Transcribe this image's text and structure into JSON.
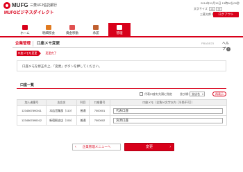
{
  "header": {
    "brand": "MUFG",
    "bank_name": "三菱UFJ信託銀行",
    "service_name": "MUFGビジネスダイレクト",
    "datetime": "2014年11月19日 13時00分00秒",
    "font_size_label": "文字サイズ",
    "font_small": "小",
    "font_large": "大",
    "user_name": "三菱太郎 様",
    "logout_label": "ログアウト"
  },
  "nav": {
    "tabs": [
      {
        "label": "ホーム",
        "icon": "home-icon",
        "color": "#d8001a",
        "active": false
      },
      {
        "label": "明細照会",
        "icon": "statement-icon",
        "color": "#e07a20",
        "active": false
      },
      {
        "label": "資金移動",
        "icon": "transfer-icon",
        "color": "#e05050",
        "active": false
      },
      {
        "label": "承認",
        "icon": "approval-icon",
        "color": "#c06030",
        "active": false
      },
      {
        "label": "管理",
        "icon": "admin-icon",
        "color": "#ffffff",
        "active": true
      }
    ]
  },
  "page": {
    "category": "企業管理",
    "title": "口座メモ変更",
    "screen_code": "PBADE23",
    "help_label": "ヘルプ",
    "help_mark": "?"
  },
  "steps": {
    "current": "口座メモを変更",
    "next": "変更完了"
  },
  "guidance": "口座メモを修正の上、「変更」ボタンを押してください。",
  "account_list": {
    "title": "口座一覧",
    "show_memo_label": "代表口座を先頭に指定",
    "sort_label": "並び順：",
    "sort_field": "支店名",
    "sort_order": "昇順",
    "sort_button": "再表示",
    "columns": [
      "加入者番号",
      "支店名",
      "科目",
      "口座番号",
      "口座メモ（全角20文字以内［半角不可］）"
    ],
    "rows": [
      {
        "subscriber": "1234567890011",
        "branch": "本店営業部（110）",
        "subject": "普通",
        "account_no": "7000001",
        "memo": "代表口座"
      },
      {
        "subscriber": "1234567890012",
        "branch": "新宿駅支店（150）",
        "subject": "普通",
        "account_no": "7000002",
        "memo": "決済口座"
      }
    ]
  },
  "buttons": {
    "back": "企業管理メニューへ",
    "back_arrow": "‹",
    "submit": "変更",
    "submit_arrow": "›"
  },
  "colors": {
    "accent": "#d8001a"
  }
}
